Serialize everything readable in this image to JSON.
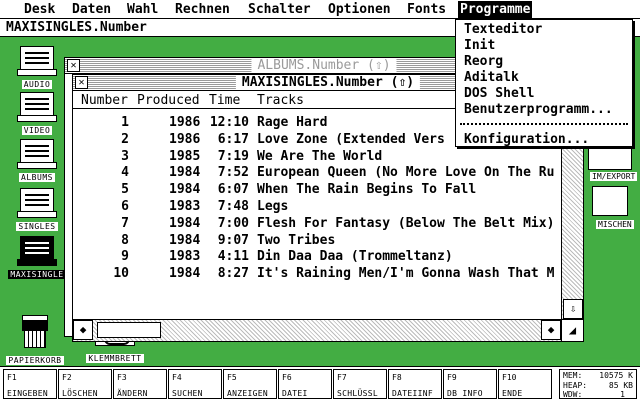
{
  "menubar": {
    "items": [
      "Desk",
      "Daten",
      "Wahl",
      "Rechnen",
      "Schalter",
      "Optionen",
      "Fonts",
      "Programme"
    ],
    "active": "Programme"
  },
  "pathbar": {
    "text": "MAXISINGLES.Number"
  },
  "desktop_icons": [
    {
      "label": "AUDIO",
      "icon": "database-file-icon"
    },
    {
      "label": "VIDEO",
      "icon": "database-file-icon"
    },
    {
      "label": "ALBUMS",
      "icon": "database-file-icon"
    },
    {
      "label": "SINGLES",
      "icon": "database-file-icon"
    },
    {
      "label": "MAXISINGLE",
      "icon": "database-file-icon",
      "selected": true
    },
    {
      "label": "PAPIERKORB",
      "icon": "trash-can-icon"
    },
    {
      "label": "KLEMMBRETT",
      "icon": "clipboard-icon"
    }
  ],
  "right_icons": [
    "IM/EXPORT",
    "MISCHEN"
  ],
  "windows": {
    "back": {
      "title": "ALBUMS.Number (⇧)"
    },
    "front": {
      "title": "MAXISINGLES.Number (⇧)",
      "columns": [
        "Number",
        "Produced",
        "Time",
        "Tracks"
      ],
      "rows": [
        {
          "number": "1",
          "produced": "1986",
          "time": "12:10",
          "track": "Rage Hard"
        },
        {
          "number": "2",
          "produced": "1986",
          "time": "6:17",
          "track": "Love Zone (Extended Vers"
        },
        {
          "number": "3",
          "produced": "1985",
          "time": "7:19",
          "track": "We Are The World"
        },
        {
          "number": "4",
          "produced": "1984",
          "time": "7:52",
          "track": "European Queen (No More Love On The Ru"
        },
        {
          "number": "5",
          "produced": "1984",
          "time": "6:07",
          "track": "When The Rain Begins To Fall"
        },
        {
          "number": "6",
          "produced": "1983",
          "time": "7:48",
          "track": "Legs"
        },
        {
          "number": "7",
          "produced": "1984",
          "time": "7:00",
          "track": "Flesh For Fantasy (Below The Belt Mix)"
        },
        {
          "number": "8",
          "produced": "1984",
          "time": "9:07",
          "track": "Two Tribes"
        },
        {
          "number": "9",
          "produced": "1983",
          "time": "4:11",
          "track": "Din Daa Daa (Trommeltanz)"
        },
        {
          "number": "10",
          "produced": "1984",
          "time": "8:27",
          "track": "It's Raining Men/I'm Gonna Wash That M"
        }
      ]
    }
  },
  "dropdown": {
    "items": [
      "Texteditor",
      "Init",
      "Reorg",
      "Aditalk",
      "DOS Shell",
      "Benutzerprogramm..."
    ],
    "footer_item": "Konfiguration..."
  },
  "function_keys": [
    {
      "key": "F1",
      "label": "EINGEBEN"
    },
    {
      "key": "F2",
      "label": "LÖSCHEN"
    },
    {
      "key": "F3",
      "label": "ÄNDERN"
    },
    {
      "key": "F4",
      "label": "SUCHEN"
    },
    {
      "key": "F5",
      "label": "ANZEIGEN"
    },
    {
      "key": "F6",
      "label": "DATEI"
    },
    {
      "key": "F7",
      "label": "SCHLÜSSL"
    },
    {
      "key": "F8",
      "label": "DATEIINF"
    },
    {
      "key": "F9",
      "label": "DB INFO"
    },
    {
      "key": "F10",
      "label": "ENDE"
    }
  ],
  "memory": {
    "mem_label": "MEM:",
    "mem_value": "10575 K",
    "heap_label": "HEAP:",
    "heap_value": "85 KB",
    "wdw_label": "WDW:",
    "wdw_value": "1"
  },
  "colors": {
    "desktop": "#43ad43",
    "window": "#ffffff",
    "ink": "#000000"
  }
}
